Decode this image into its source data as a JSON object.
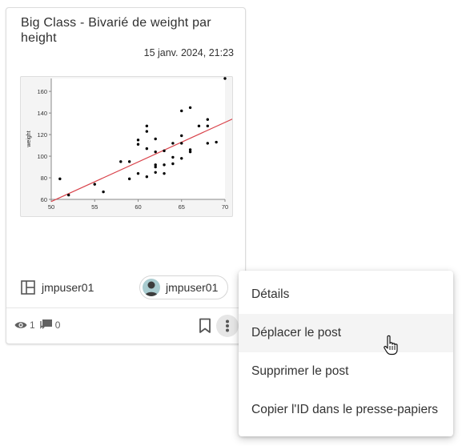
{
  "card": {
    "title": "Big Class - Bivarié de weight par height",
    "date": "15 janv. 2024, 21:23",
    "author_label": "jmpuser01",
    "user_chip_label": "jmpuser01",
    "views": "1",
    "comments": "0"
  },
  "chart_data": {
    "type": "scatter",
    "title": "",
    "xlabel": "",
    "ylabel": "weight",
    "xlim": [
      50,
      70
    ],
    "ylim": [
      60,
      172
    ],
    "xticks": [
      "50",
      "55",
      "60",
      "65",
      "70"
    ],
    "yticks": [
      "60",
      "80",
      "100",
      "120",
      "140",
      "160"
    ],
    "points": [
      [
        51,
        79
      ],
      [
        52,
        64
      ],
      [
        55,
        74
      ],
      [
        56,
        67
      ],
      [
        58,
        95
      ],
      [
        59,
        95
      ],
      [
        59,
        79
      ],
      [
        60,
        111
      ],
      [
        60,
        115
      ],
      [
        60,
        84
      ],
      [
        61,
        128
      ],
      [
        61,
        123
      ],
      [
        61,
        107
      ],
      [
        61,
        81
      ],
      [
        62,
        116
      ],
      [
        62,
        104
      ],
      [
        62,
        92
      ],
      [
        62,
        90
      ],
      [
        62,
        85
      ],
      [
        63,
        105
      ],
      [
        63,
        92
      ],
      [
        63,
        84
      ],
      [
        64,
        112
      ],
      [
        64,
        99
      ],
      [
        64,
        93
      ],
      [
        65,
        142
      ],
      [
        65,
        119
      ],
      [
        65,
        112
      ],
      [
        65,
        98
      ],
      [
        66,
        145
      ],
      [
        66,
        106
      ],
      [
        66,
        104
      ],
      [
        67,
        128
      ],
      [
        68,
        134
      ],
      [
        68,
        128
      ],
      [
        68,
        112
      ],
      [
        69,
        113
      ],
      [
        70,
        172
      ]
    ],
    "fit_line": {
      "color": "#d9434b",
      "x": [
        50,
        71
      ],
      "y": [
        58,
        135
      ]
    },
    "point_color": "#000000"
  },
  "menu": {
    "items": [
      {
        "label": "Détails",
        "hover": false
      },
      {
        "label": "Déplacer le post",
        "hover": true
      },
      {
        "label": "Supprimer le post",
        "hover": false
      },
      {
        "label": "Copier l'ID dans le presse-papiers",
        "hover": false
      }
    ]
  }
}
